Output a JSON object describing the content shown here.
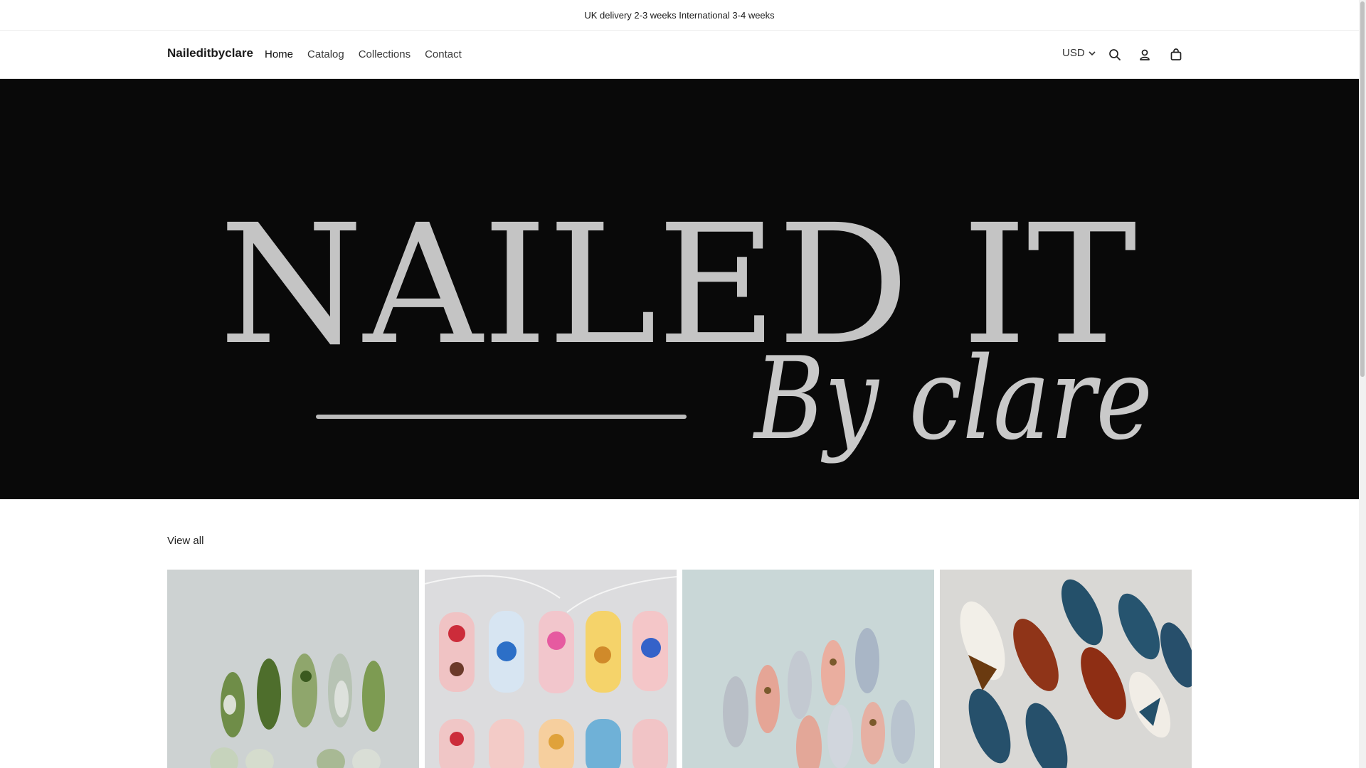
{
  "announcement": {
    "text": "UK delivery 2-3 weeks International 3-4 weeks"
  },
  "header": {
    "brand": "Naileditbyclare",
    "nav": [
      {
        "label": "Home",
        "active": true
      },
      {
        "label": "Catalog",
        "active": false
      },
      {
        "label": "Collections",
        "active": false
      },
      {
        "label": "Contact",
        "active": false
      }
    ],
    "currency": "USD",
    "icons": [
      "search-icon",
      "account-icon",
      "cart-icon"
    ]
  },
  "hero": {
    "logo_line1": "NAILED IT",
    "logo_line2": "By clare",
    "background": "#090909",
    "text_color": "#c9c9c9"
  },
  "collection": {
    "view_all": "View all",
    "products": [
      {
        "name": "product-green-chrome-nails",
        "palette": [
          "#cfd3d3",
          "#5f7f3a",
          "#b9c7b0"
        ]
      },
      {
        "name": "product-floral-pink-nails",
        "palette": [
          "#d9dadc",
          "#f1c3c6",
          "#3e7cc4"
        ]
      },
      {
        "name": "product-pink-chrome-nails",
        "palette": [
          "#c8d6d6",
          "#e8a99b",
          "#b6bcc4"
        ]
      },
      {
        "name": "product-blue-red-tortoise-nails",
        "palette": [
          "#d7d7d5",
          "#24506a",
          "#8a2c14"
        ]
      }
    ]
  }
}
